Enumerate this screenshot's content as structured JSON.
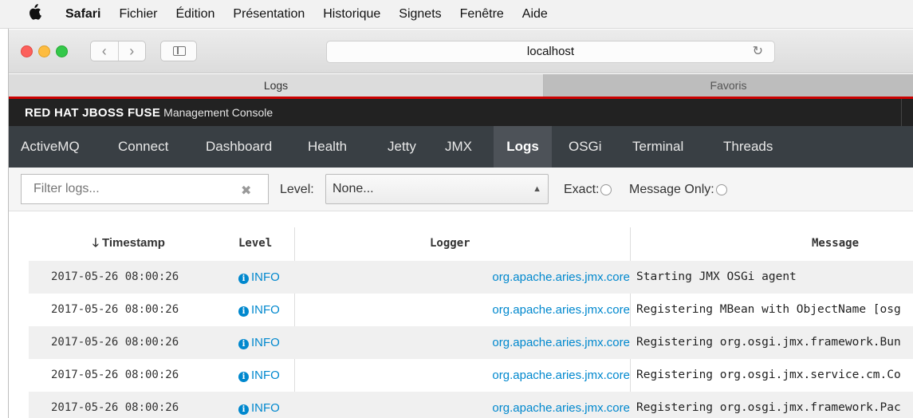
{
  "menubar": {
    "app": "Safari",
    "items": [
      "Fichier",
      "Édition",
      "Présentation",
      "Historique",
      "Signets",
      "Fenêtre",
      "Aide"
    ]
  },
  "toolbar": {
    "address": "localhost",
    "back_icon": "chevron-left",
    "forward_icon": "chevron-right",
    "reload_icon": "reload"
  },
  "tabs": [
    {
      "label": "Logs",
      "active": true
    },
    {
      "label": "Favoris",
      "active": false
    }
  ],
  "console": {
    "brand_bold": "RED HAT JBOSS FUSE",
    "brand_light": "Management Console",
    "nav": [
      "ActiveMQ",
      "Connect",
      "Dashboard",
      "Health",
      "Jetty",
      "JMX",
      "Logs",
      "OSGi",
      "Terminal",
      "Threads"
    ],
    "active_nav": "Logs"
  },
  "filters": {
    "search_placeholder": "Filter logs...",
    "level_label": "Level:",
    "level_value": "None...",
    "exact_label": "Exact:",
    "message_only_label": "Message Only:"
  },
  "table": {
    "sort_arrow": "🡓",
    "headers": {
      "timestamp": "Timestamp",
      "level": "Level",
      "logger": "Logger",
      "message": "Message"
    },
    "rows": [
      {
        "timestamp": "2017-05-26 08:00:26",
        "level": "INFO",
        "logger": "org.apache.aries.jmx.core",
        "message": "Starting JMX OSGi agent"
      },
      {
        "timestamp": "2017-05-26 08:00:26",
        "level": "INFO",
        "logger": "org.apache.aries.jmx.core",
        "message": "Registering MBean with ObjectName [osg"
      },
      {
        "timestamp": "2017-05-26 08:00:26",
        "level": "INFO",
        "logger": "org.apache.aries.jmx.core",
        "message": "Registering org.osgi.jmx.framework.Bun"
      },
      {
        "timestamp": "2017-05-26 08:00:26",
        "level": "INFO",
        "logger": "org.apache.aries.jmx.core",
        "message": "Registering org.osgi.jmx.service.cm.Co"
      },
      {
        "timestamp": "2017-05-26 08:00:26",
        "level": "INFO",
        "logger": "org.apache.aries.jmx.core",
        "message": "Registering org.osgi.jmx.framework.Pac"
      }
    ]
  },
  "colors": {
    "accent_red": "#cc0000",
    "nav_bg": "#393f44",
    "link_blue": "#0088ce"
  }
}
